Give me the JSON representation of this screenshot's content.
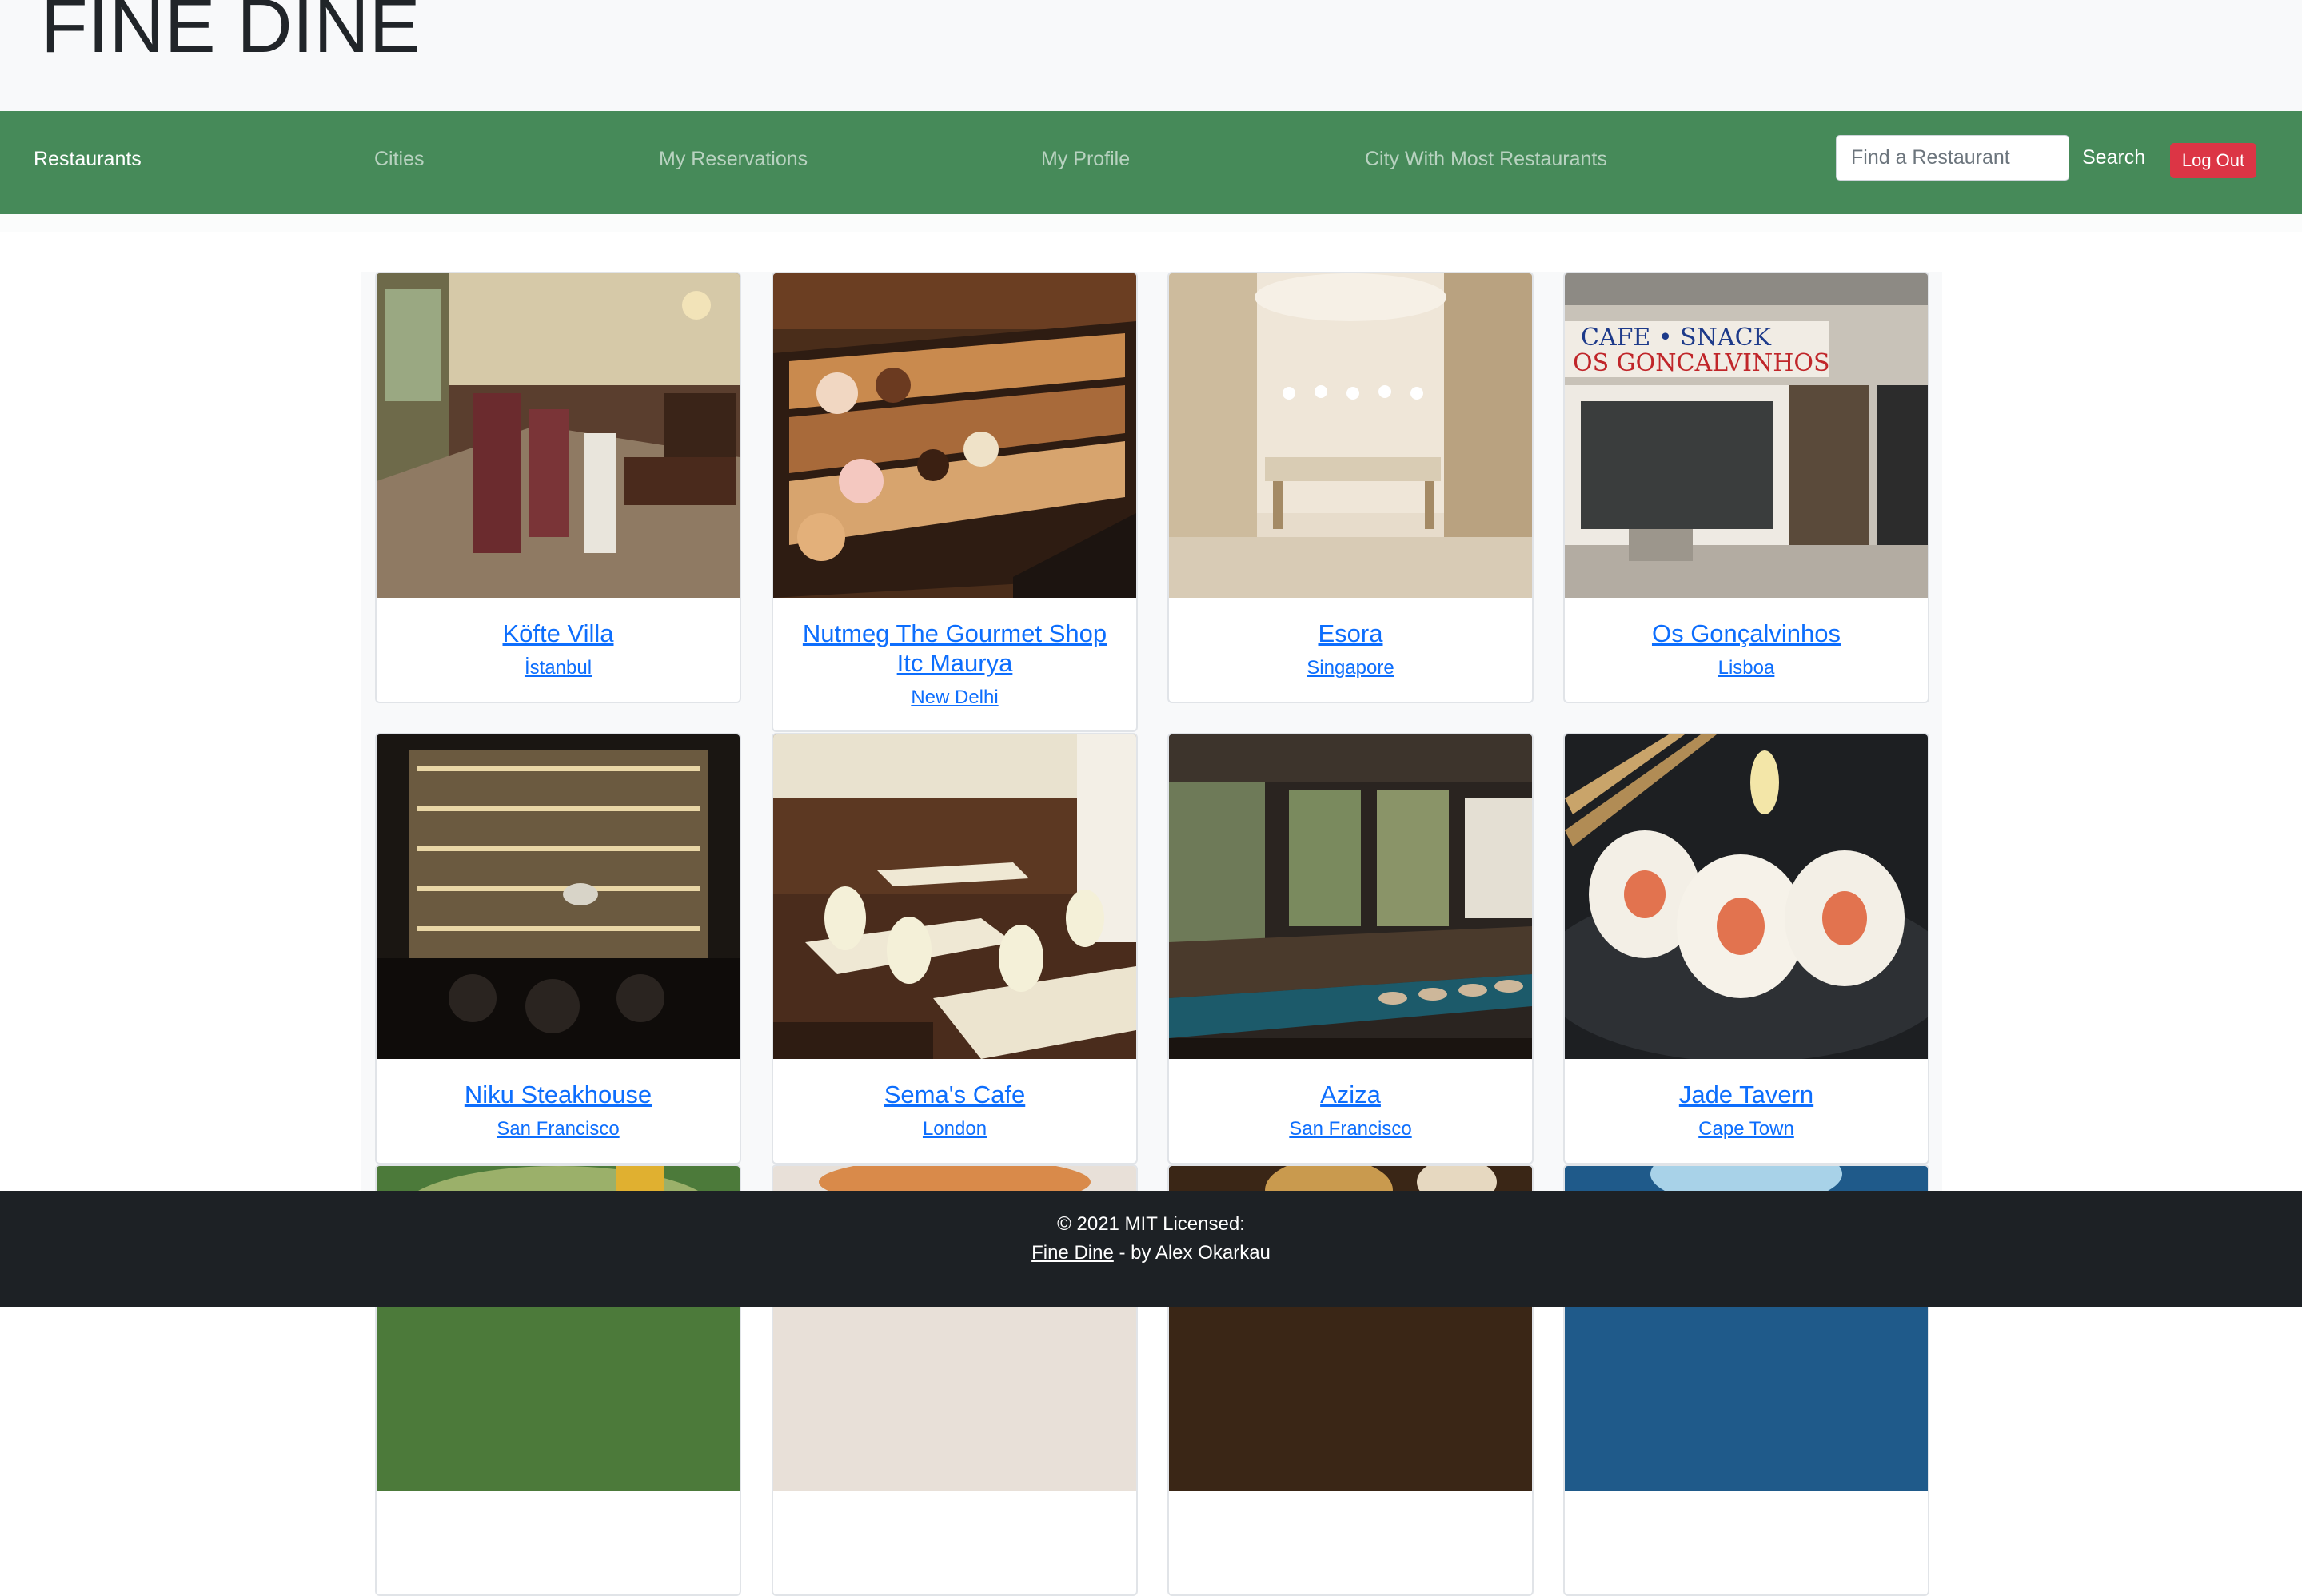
{
  "brand": {
    "title": "FINE DINE"
  },
  "nav": {
    "items": [
      {
        "label": "Restaurants",
        "active": true
      },
      {
        "label": "Cities",
        "active": false
      },
      {
        "label": "My Reservations",
        "active": false
      },
      {
        "label": "My Profile",
        "active": false
      },
      {
        "label": "City With Most Restaurants",
        "active": false
      }
    ],
    "search_placeholder": "Find a Restaurant",
    "search_value": "",
    "search_label": "Search",
    "logout_label": "Log Out"
  },
  "restaurants": [
    {
      "name": "Köfte Villa",
      "city": "İstanbul",
      "image": "restaurant-interior-photo"
    },
    {
      "name": "Nutmeg The Gourmet Shop Itc Maurya",
      "city": "New Delhi",
      "image": "pastry-display-photo"
    },
    {
      "name": "Esora",
      "city": "Singapore",
      "image": "dining-room-photo"
    },
    {
      "name": "Os Gonçalvinhos",
      "city": "Lisboa",
      "image": "storefront-photo"
    },
    {
      "name": "Niku Steakhouse",
      "city": "San Francisco",
      "image": "bar-interior-photo"
    },
    {
      "name": "Sema's Cafe",
      "city": "London",
      "image": "cafe-interior-photo"
    },
    {
      "name": "Aziza",
      "city": "San Francisco",
      "image": "bar-counter-photo"
    },
    {
      "name": "Jade Tavern",
      "city": "Cape Town",
      "image": "sushi-photo"
    },
    {
      "name": "",
      "city": "",
      "image": "food-photo"
    },
    {
      "name": "",
      "city": "",
      "image": "food-photo"
    },
    {
      "name": "",
      "city": "",
      "image": "food-photo"
    },
    {
      "name": "",
      "city": "",
      "image": "food-photo"
    }
  ],
  "footer": {
    "copyright": "© 2021 MIT Licensed:",
    "link_label": "Fine Dine",
    "byline": " - by Alex Okarkau"
  },
  "colors": {
    "navbar": "#468a59",
    "logout": "#dc3545",
    "link": "#0d6efd",
    "footer": "#1d2125"
  }
}
